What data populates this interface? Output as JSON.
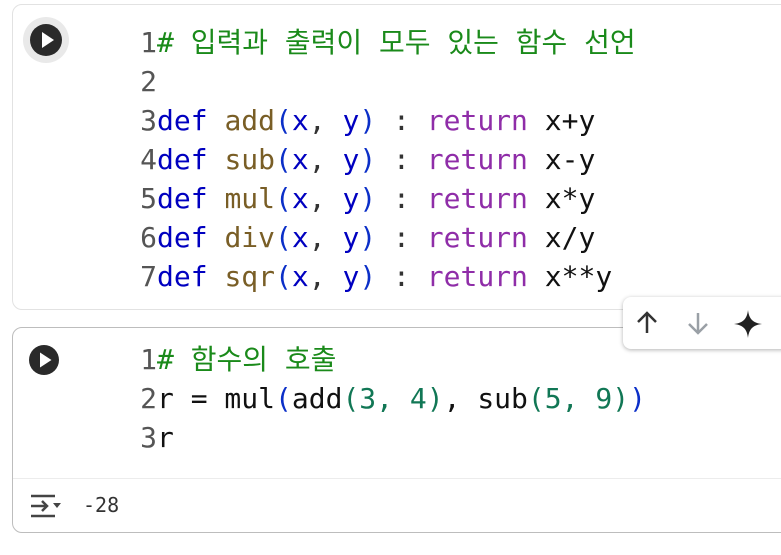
{
  "cells": [
    {
      "lines": [
        {
          "num": "1",
          "tokens": [
            {
              "c": "cm",
              "t": "# 입력과 출력이 모두 있는 함수 선언"
            }
          ]
        },
        {
          "num": "2",
          "tokens": []
        },
        {
          "num": "3",
          "tokens": [
            {
              "c": "kw",
              "t": "def"
            },
            {
              "c": "pl",
              "t": " "
            },
            {
              "c": "fn",
              "t": "add"
            },
            {
              "c": "pr",
              "t": "("
            },
            {
              "c": "kw",
              "t": "x"
            },
            {
              "c": "op",
              "t": ", "
            },
            {
              "c": "kw",
              "t": "y"
            },
            {
              "c": "pr",
              "t": ")"
            },
            {
              "c": "pl",
              "t": " "
            },
            {
              "c": "op",
              "t": ":"
            },
            {
              "c": "pl",
              "t": " "
            },
            {
              "c": "rt",
              "t": "return"
            },
            {
              "c": "pl",
              "t": " x+y"
            }
          ]
        },
        {
          "num": "4",
          "tokens": [
            {
              "c": "kw",
              "t": "def"
            },
            {
              "c": "pl",
              "t": " "
            },
            {
              "c": "fn",
              "t": "sub"
            },
            {
              "c": "pr",
              "t": "("
            },
            {
              "c": "kw",
              "t": "x"
            },
            {
              "c": "op",
              "t": ", "
            },
            {
              "c": "kw",
              "t": "y"
            },
            {
              "c": "pr",
              "t": ")"
            },
            {
              "c": "pl",
              "t": " "
            },
            {
              "c": "op",
              "t": ":"
            },
            {
              "c": "pl",
              "t": " "
            },
            {
              "c": "rt",
              "t": "return"
            },
            {
              "c": "pl",
              "t": " x-y"
            }
          ]
        },
        {
          "num": "5",
          "tokens": [
            {
              "c": "kw",
              "t": "def"
            },
            {
              "c": "pl",
              "t": " "
            },
            {
              "c": "fn",
              "t": "mul"
            },
            {
              "c": "pr",
              "t": "("
            },
            {
              "c": "kw",
              "t": "x"
            },
            {
              "c": "op",
              "t": ", "
            },
            {
              "c": "kw",
              "t": "y"
            },
            {
              "c": "pr",
              "t": ")"
            },
            {
              "c": "pl",
              "t": " "
            },
            {
              "c": "op",
              "t": ":"
            },
            {
              "c": "pl",
              "t": " "
            },
            {
              "c": "rt",
              "t": "return"
            },
            {
              "c": "pl",
              "t": " x*y"
            }
          ]
        },
        {
          "num": "6",
          "tokens": [
            {
              "c": "kw",
              "t": "def"
            },
            {
              "c": "pl",
              "t": " "
            },
            {
              "c": "fn",
              "t": "div"
            },
            {
              "c": "pr",
              "t": "("
            },
            {
              "c": "kw",
              "t": "x"
            },
            {
              "c": "op",
              "t": ", "
            },
            {
              "c": "kw",
              "t": "y"
            },
            {
              "c": "pr",
              "t": ")"
            },
            {
              "c": "pl",
              "t": " "
            },
            {
              "c": "op",
              "t": ":"
            },
            {
              "c": "pl",
              "t": " "
            },
            {
              "c": "rt",
              "t": "return"
            },
            {
              "c": "pl",
              "t": " x/y"
            }
          ]
        },
        {
          "num": "7",
          "tokens": [
            {
              "c": "kw",
              "t": "def"
            },
            {
              "c": "pl",
              "t": " "
            },
            {
              "c": "fn",
              "t": "sqr"
            },
            {
              "c": "pr",
              "t": "("
            },
            {
              "c": "kw",
              "t": "x"
            },
            {
              "c": "op",
              "t": ", "
            },
            {
              "c": "kw",
              "t": "y"
            },
            {
              "c": "pr",
              "t": ")"
            },
            {
              "c": "pl",
              "t": " "
            },
            {
              "c": "op",
              "t": ":"
            },
            {
              "c": "pl",
              "t": " "
            },
            {
              "c": "rt",
              "t": "return"
            },
            {
              "c": "pl",
              "t": " x**y"
            }
          ]
        }
      ]
    },
    {
      "lines": [
        {
          "num": "1",
          "tokens": [
            {
              "c": "cm",
              "t": "# 함수의 호출"
            }
          ]
        },
        {
          "num": "2",
          "tokens": [
            {
              "c": "pl",
              "t": "r = mul"
            },
            {
              "c": "pr",
              "t": "("
            },
            {
              "c": "pl",
              "t": "add"
            },
            {
              "c": "num",
              "t": "(3, 4)"
            },
            {
              "c": "pl",
              "t": ", sub"
            },
            {
              "c": "num",
              "t": "(5, 9)"
            },
            {
              "c": "pr",
              "t": ")"
            }
          ]
        },
        {
          "num": "3",
          "tokens": [
            {
              "c": "pl",
              "t": "r"
            }
          ]
        }
      ],
      "output": "-28"
    }
  ],
  "icons": {
    "run": "play-icon",
    "output_toggle": "output-toggle-icon",
    "move_up": "arrow-up-icon",
    "move_down": "arrow-down-icon",
    "gemini": "sparkle-icon"
  }
}
